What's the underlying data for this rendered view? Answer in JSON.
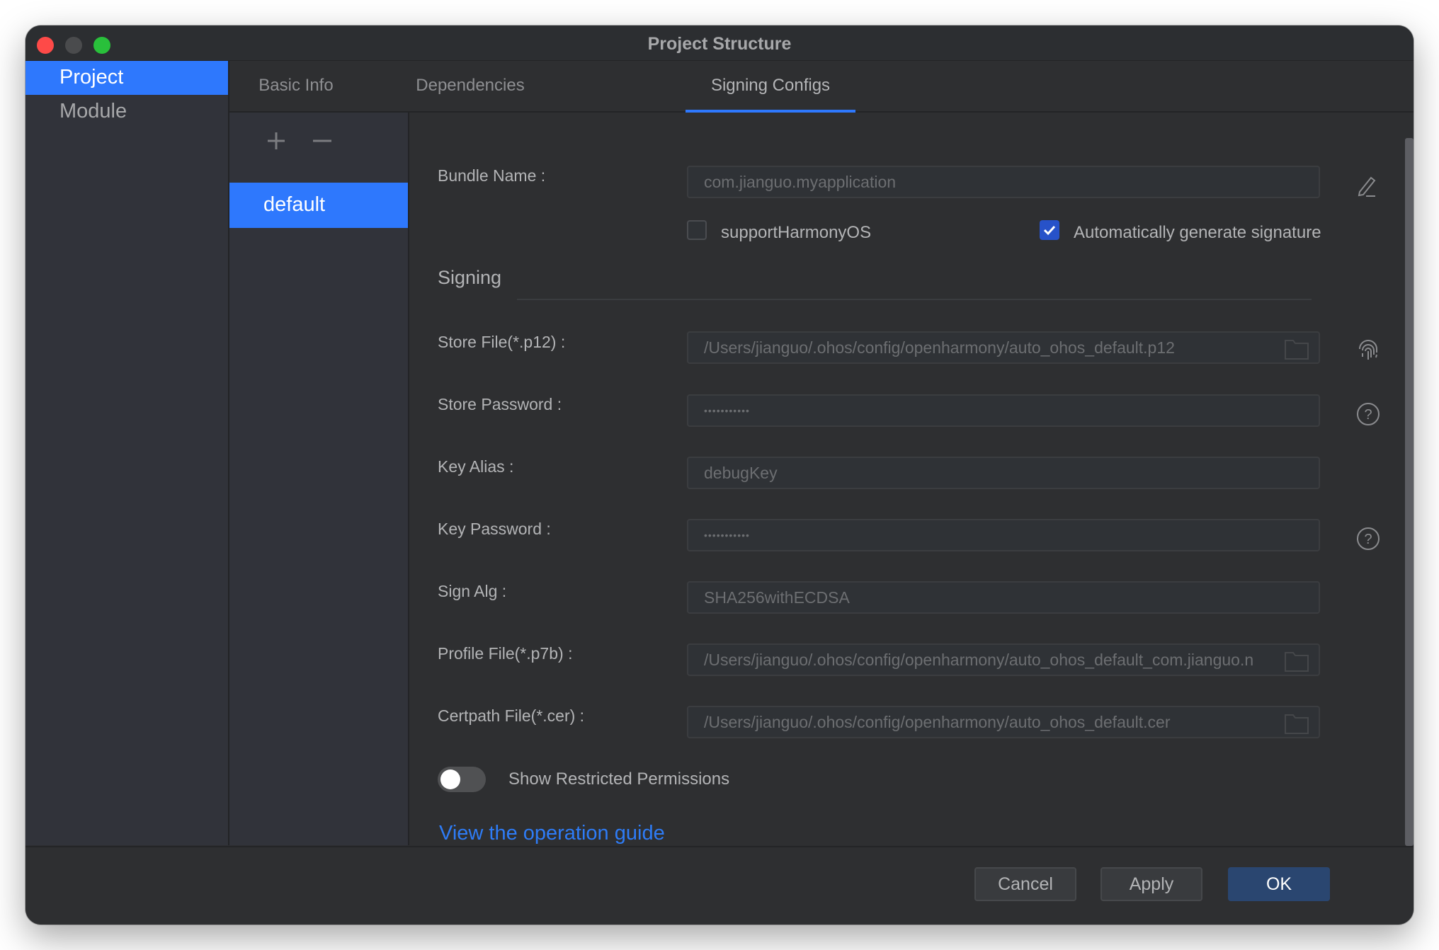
{
  "window": {
    "title": "Project Structure",
    "traffic_lights": {
      "close": "#fe4a48",
      "minimize": "#4a4b4d",
      "maximize": "#29c03b"
    }
  },
  "sidebar": {
    "items": [
      {
        "label": "Project",
        "active": true
      },
      {
        "label": "Module",
        "active": false
      }
    ]
  },
  "tabs": [
    {
      "label": "Basic Info",
      "active": false
    },
    {
      "label": "Dependencies",
      "active": false
    },
    {
      "label": "Signing Configs",
      "active": true
    }
  ],
  "configs": {
    "add_icon": "plus-icon",
    "remove_icon": "minus-icon",
    "items": [
      {
        "label": "default",
        "selected": true
      }
    ]
  },
  "form": {
    "bundle_name": {
      "label": "Bundle Name :",
      "value": "com.jianguo.myapplication",
      "action_icon": "edit-pencil-icon"
    },
    "support_harmonyos": {
      "label": "supportHarmonyOS",
      "checked": false
    },
    "auto_signature": {
      "label": "Automatically generate signature",
      "checked": true
    },
    "section_title": "Signing",
    "store_file": {
      "label": "Store File(*.p12) :",
      "value": "/Users/jianguo/.ohos/config/openharmony/auto_ohos_default.p12",
      "icon": "folder-icon",
      "action_icon": "fingerprint-icon"
    },
    "store_password": {
      "label": "Store Password :",
      "value": "•••••••••••",
      "action_icon": "help-circle-icon"
    },
    "key_alias": {
      "label": "Key Alias :",
      "value": "debugKey"
    },
    "key_password": {
      "label": "Key Password :",
      "value": "•••••••••••",
      "action_icon": "help-circle-icon"
    },
    "sign_alg": {
      "label": "Sign Alg :",
      "value": "SHA256withECDSA"
    },
    "profile_file": {
      "label": "Profile File(*.p7b) :",
      "value": "/Users/jianguo/.ohos/config/openharmony/auto_ohos_default_com.jianguo.n",
      "icon": "folder-icon"
    },
    "certpath_file": {
      "label": "Certpath File(*.cer) :",
      "value": "/Users/jianguo/.ohos/config/openharmony/auto_ohos_default.cer",
      "icon": "folder-icon"
    },
    "restricted_toggle": {
      "label": "Show Restricted Permissions",
      "on": false
    },
    "guide_link": "View the operation guide"
  },
  "footer": {
    "cancel": "Cancel",
    "apply": "Apply",
    "ok": "OK"
  },
  "colors": {
    "accent": "#2e78fd",
    "primary_button": "#2a4670",
    "link": "#2e7cf6",
    "checkbox_checked": "#2752c9"
  }
}
